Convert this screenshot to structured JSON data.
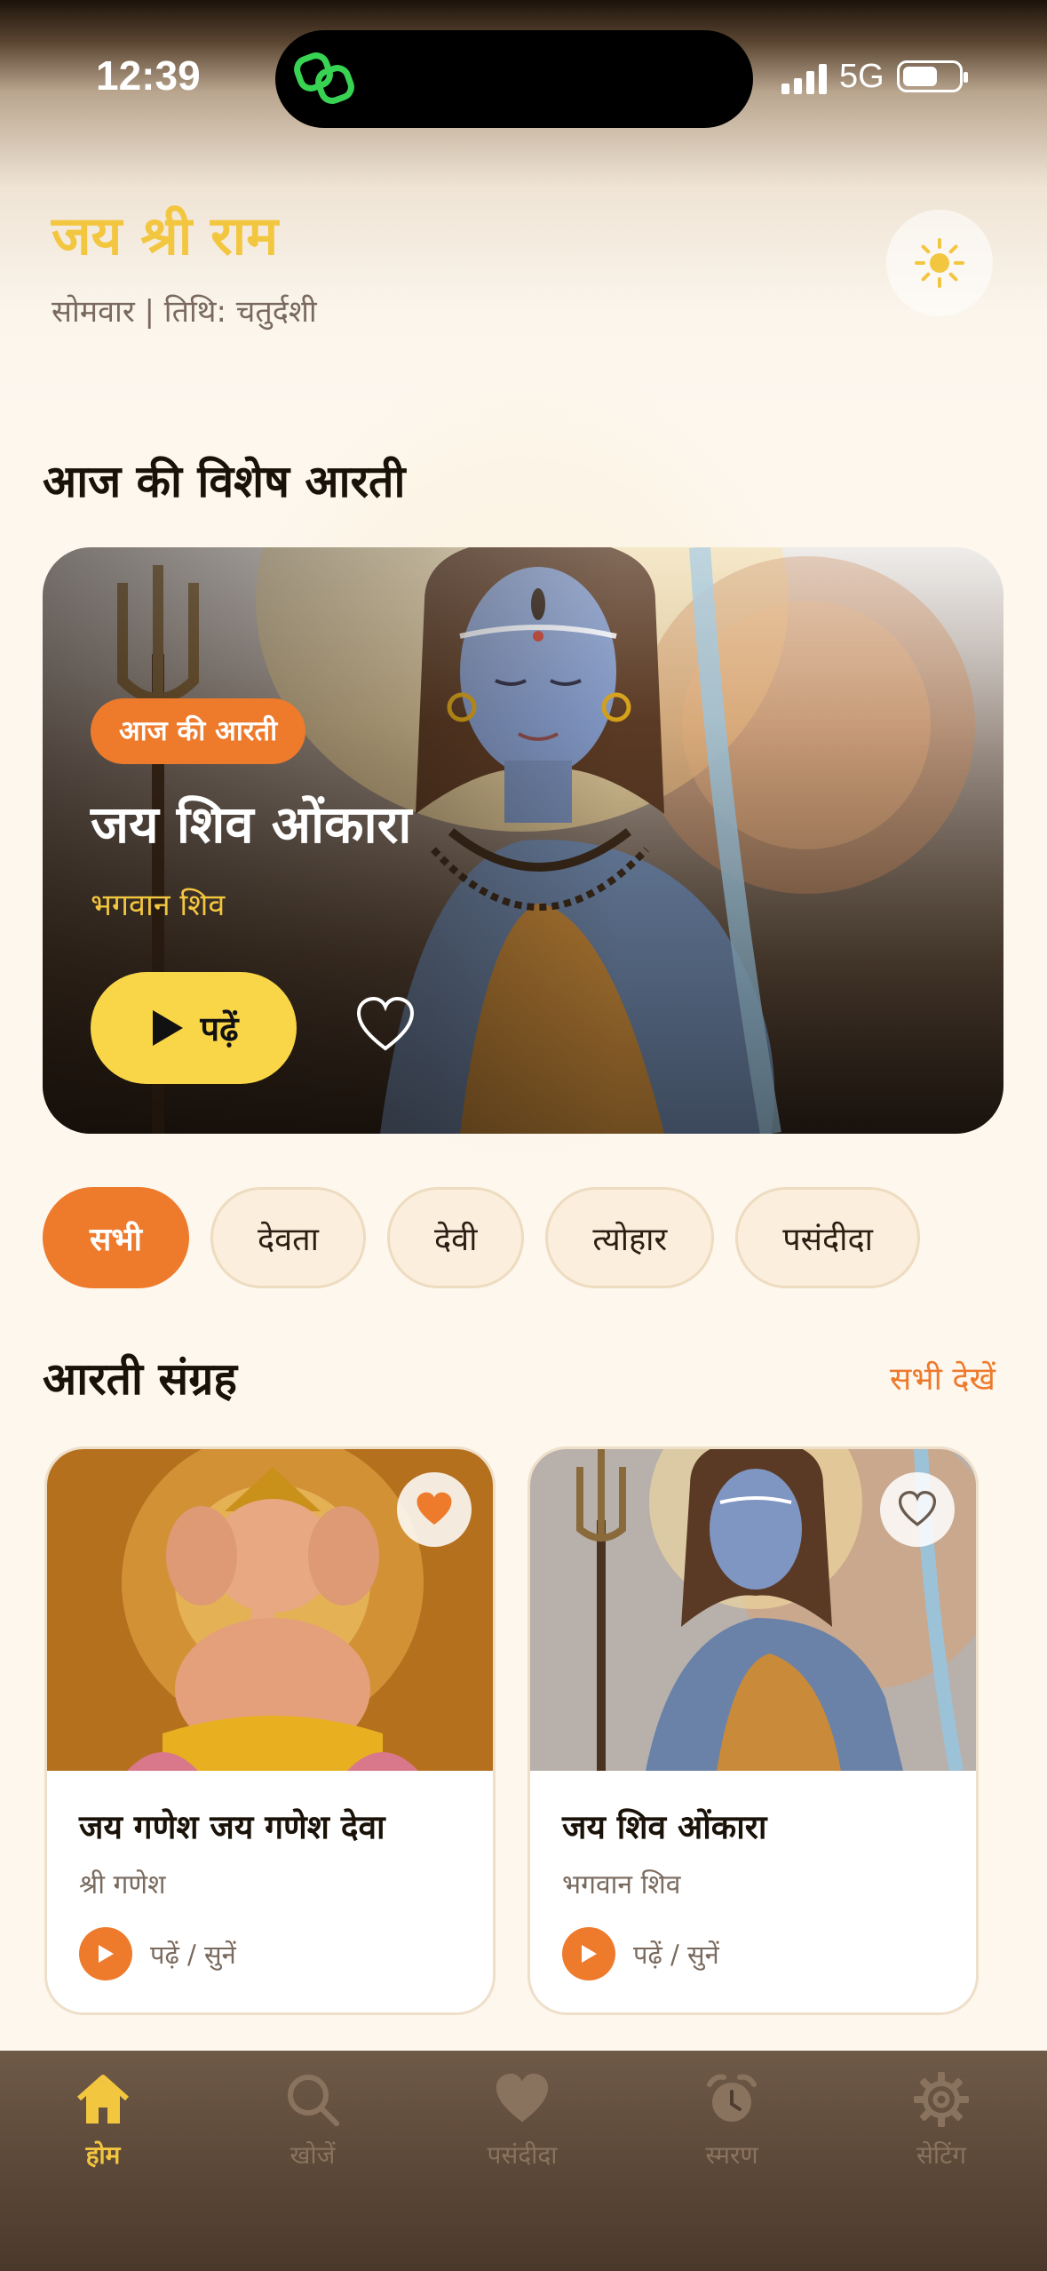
{
  "status_bar": {
    "time": "12:39",
    "network": "5G"
  },
  "header": {
    "greeting": "जय श्री राम",
    "date_line": "सोमवार | तिथि: चतुर्दशी",
    "theme_icon": "sun-icon"
  },
  "featured": {
    "section_title": "आज की विशेष आरती",
    "badge": "आज की आरती",
    "title": "जय शिव ओंकारा",
    "deity": "भगवान शिव",
    "read_label": "पढ़ें",
    "favorited": false
  },
  "filters": {
    "active": "सभी",
    "items": [
      "सभी",
      "देवता",
      "देवी",
      "त्योहार",
      "पसंदीदा"
    ]
  },
  "collection": {
    "section_title": "आरती संग्रह",
    "see_all": "सभी देखें",
    "cards": [
      {
        "title": "जय गणेश जय गणेश देवा",
        "deity": "श्री गणेश",
        "action": "पढ़ें / सुनें",
        "favorited": true
      },
      {
        "title": "जय शिव ओंकारा",
        "deity": "भगवान शिव",
        "action": "पढ़ें / सुनें",
        "favorited": false
      }
    ]
  },
  "nav": {
    "active": "होम",
    "items": [
      {
        "label": "होम",
        "icon": "home-icon"
      },
      {
        "label": "खोजें",
        "icon": "search-icon"
      },
      {
        "label": "पसंदीदा",
        "icon": "heart-icon"
      },
      {
        "label": "स्मरण",
        "icon": "alarm-clock-icon"
      },
      {
        "label": "सेटिंग",
        "icon": "gear-icon"
      }
    ]
  },
  "colors": {
    "accent_orange": "#ee7a2c",
    "accent_yellow": "#f9d548",
    "greeting_gold": "#f3c640",
    "background": "#fdf7ee"
  }
}
